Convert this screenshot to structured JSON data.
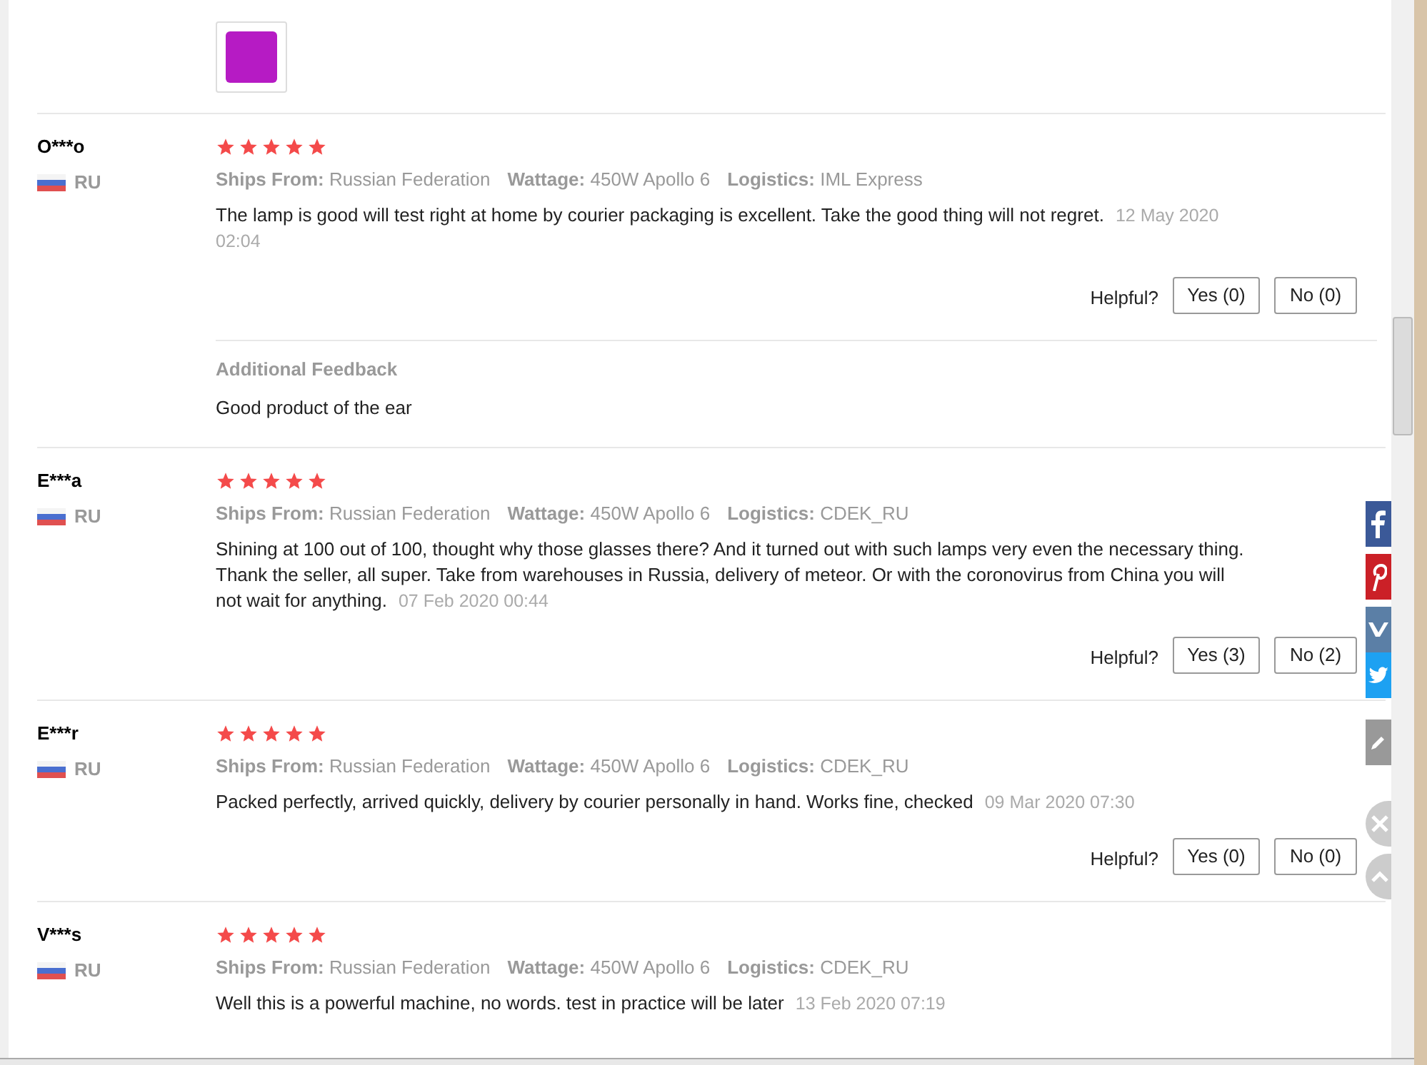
{
  "reviews": [
    {
      "name": "O***o",
      "country": "RU",
      "stars": 5,
      "attributes": [
        {
          "label": "Ships From:",
          "value": "Russian Federation"
        },
        {
          "label": "Wattage:",
          "value": "450W Apollo 6"
        },
        {
          "label": "Logistics:",
          "value": "IML Express"
        }
      ],
      "text": "The lamp is good will test right at home by courier packaging is excellent. Take the good thing will not regret.",
      "date": "12 May 2020 02:04",
      "helpful_label": "Helpful?",
      "yes": "Yes (0)",
      "no": "No (0)",
      "additional_feedback": {
        "title": "Additional Feedback",
        "text": "Good product of the ear"
      }
    },
    {
      "name": "E***a",
      "country": "RU",
      "stars": 5,
      "attributes": [
        {
          "label": "Ships From:",
          "value": "Russian Federation"
        },
        {
          "label": "Wattage:",
          "value": "450W Apollo 6"
        },
        {
          "label": "Logistics:",
          "value": "CDEK_RU"
        }
      ],
      "text": "Shining at 100 out of 100, thought why those glasses there? And it turned out with such lamps very even the necessary thing. Thank the seller, all super. Take from warehouses in Russia, delivery of meteor. Or with the coronovirus from China you will not wait for anything.",
      "date": "07 Feb 2020 00:44",
      "helpful_label": "Helpful?",
      "yes": "Yes (3)",
      "no": "No (2)"
    },
    {
      "name": "E***r",
      "country": "RU",
      "stars": 5,
      "attributes": [
        {
          "label": "Ships From:",
          "value": "Russian Federation"
        },
        {
          "label": "Wattage:",
          "value": "450W Apollo 6"
        },
        {
          "label": "Logistics:",
          "value": "CDEK_RU"
        }
      ],
      "text": "Packed perfectly, arrived quickly, delivery by courier personally in hand. Works fine, checked",
      "date": "09 Mar 2020 07:30",
      "helpful_label": "Helpful?",
      "yes": "Yes (0)",
      "no": "No (0)"
    },
    {
      "name": "V***s",
      "country": "RU",
      "stars": 5,
      "attributes": [
        {
          "label": "Ships From:",
          "value": "Russian Federation"
        },
        {
          "label": "Wattage:",
          "value": "450W Apollo 6"
        },
        {
          "label": "Logistics:",
          "value": "CDEK_RU"
        }
      ],
      "text": "Well this is a powerful machine, no words. test in practice will be later",
      "date": "13 Feb 2020 07:19"
    }
  ]
}
